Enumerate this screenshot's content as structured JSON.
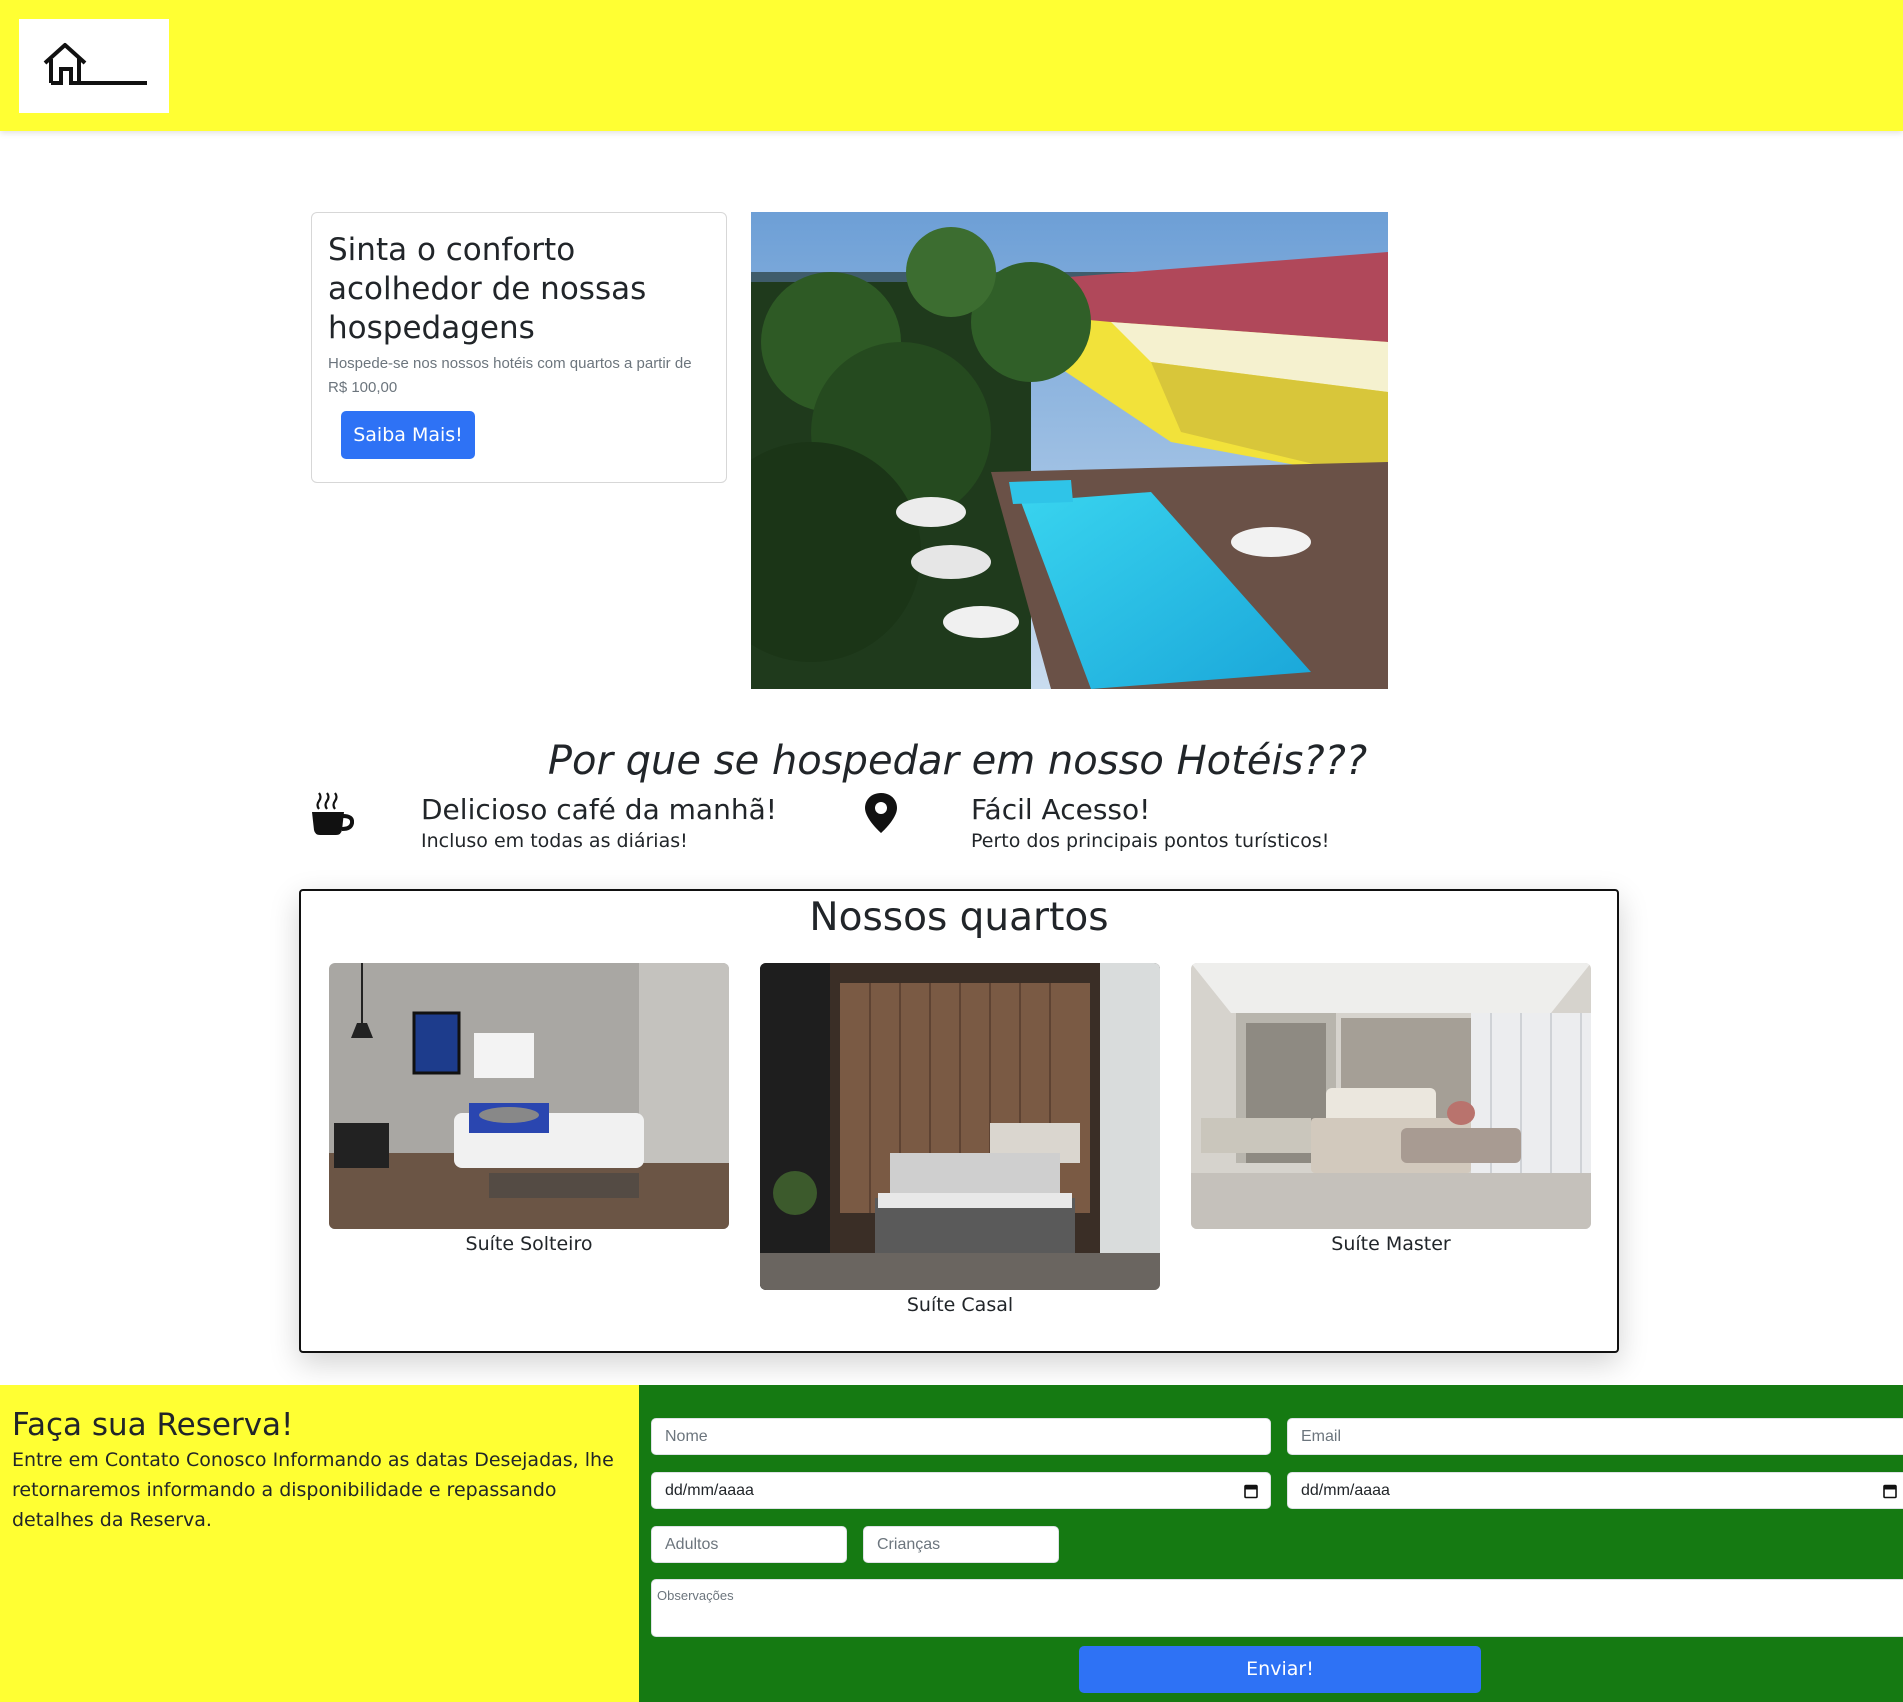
{
  "header": {
    "logo_icon": "house-outline-icon",
    "background": "#ffff33"
  },
  "hero": {
    "title": "Sinta o conforto acolhedor de nossas hospedagens",
    "text": "Hospede-se nos nossos hotéis com quartos a partir de R$ 100,00",
    "button_label": "Saiba Mais!",
    "image_icon": "hotel-pool-photo"
  },
  "why": {
    "title": "Por que se hospedar em nosso Hotéis???",
    "features": [
      {
        "icon": "coffee-cup-icon",
        "title": "Delicioso café da manhã!",
        "subtitle": "Incluso em todas as diárias!"
      },
      {
        "icon": "location-pin-icon",
        "title": "Fácil Acesso!",
        "subtitle": "Perto dos principais pontos turísticos!"
      }
    ]
  },
  "rooms": {
    "title": "Nossos quartos",
    "items": [
      {
        "label": "Suíte Solteiro"
      },
      {
        "label": "Suíte Casal"
      },
      {
        "label": "Suíte Master"
      }
    ]
  },
  "reservation": {
    "title": "Faça sua Reserva!",
    "text": "Entre em Contato Conosco Informando as datas Desejadas, lhe retornaremos informando a disponibilidade e repassando detalhes da Reserva.",
    "form": {
      "name_placeholder": "Nome",
      "email_placeholder": "Email",
      "checkin_placeholder": "dd/mm/aaaa",
      "checkout_placeholder": "dd/mm/aaaa",
      "adults_placeholder": "Adultos",
      "children_placeholder": "Crianças",
      "notes_placeholder": "Observações",
      "submit_label": "Enviar!"
    },
    "colors": {
      "left_bg": "#ffff33",
      "right_bg": "#157a12",
      "button": "#2e72f5"
    }
  }
}
